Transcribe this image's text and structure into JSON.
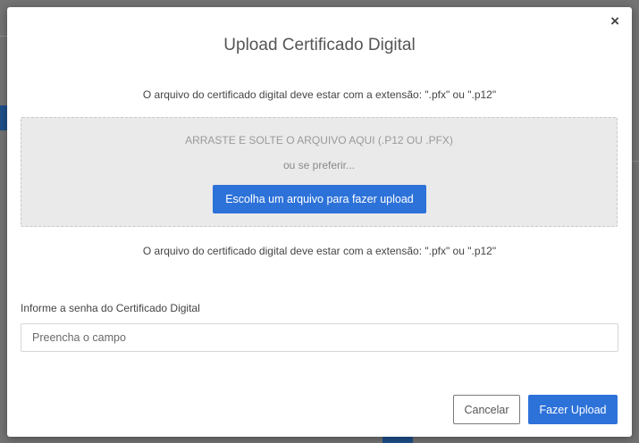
{
  "modal": {
    "title": "Upload Certificado Digital",
    "close_glyph": "×",
    "hint_top": "O arquivo do certificado digital deve estar com a extensão: \".pfx\" ou \".p12\"",
    "hint_bottom": "O arquivo do certificado digital deve estar com a extensão: \".pfx\" ou \".p12\""
  },
  "dropzone": {
    "instruction": "ARRASTE E SOLTE O ARQUIVO AQUI (.P12 OU .PFX)",
    "alternative": "ou se preferir...",
    "choose_button": "Escolha um arquivo para fazer upload"
  },
  "password": {
    "label": "Informe a senha do Certificado Digital",
    "placeholder": "Preencha o campo",
    "value": ""
  },
  "footer": {
    "cancel_label": "Cancelar",
    "upload_label": "Fazer Upload"
  },
  "colors": {
    "primary": "#2d72d9",
    "dropzone_bg": "#eaeaea",
    "overlay": "#737373"
  },
  "icons": {
    "close": "close-icon"
  }
}
